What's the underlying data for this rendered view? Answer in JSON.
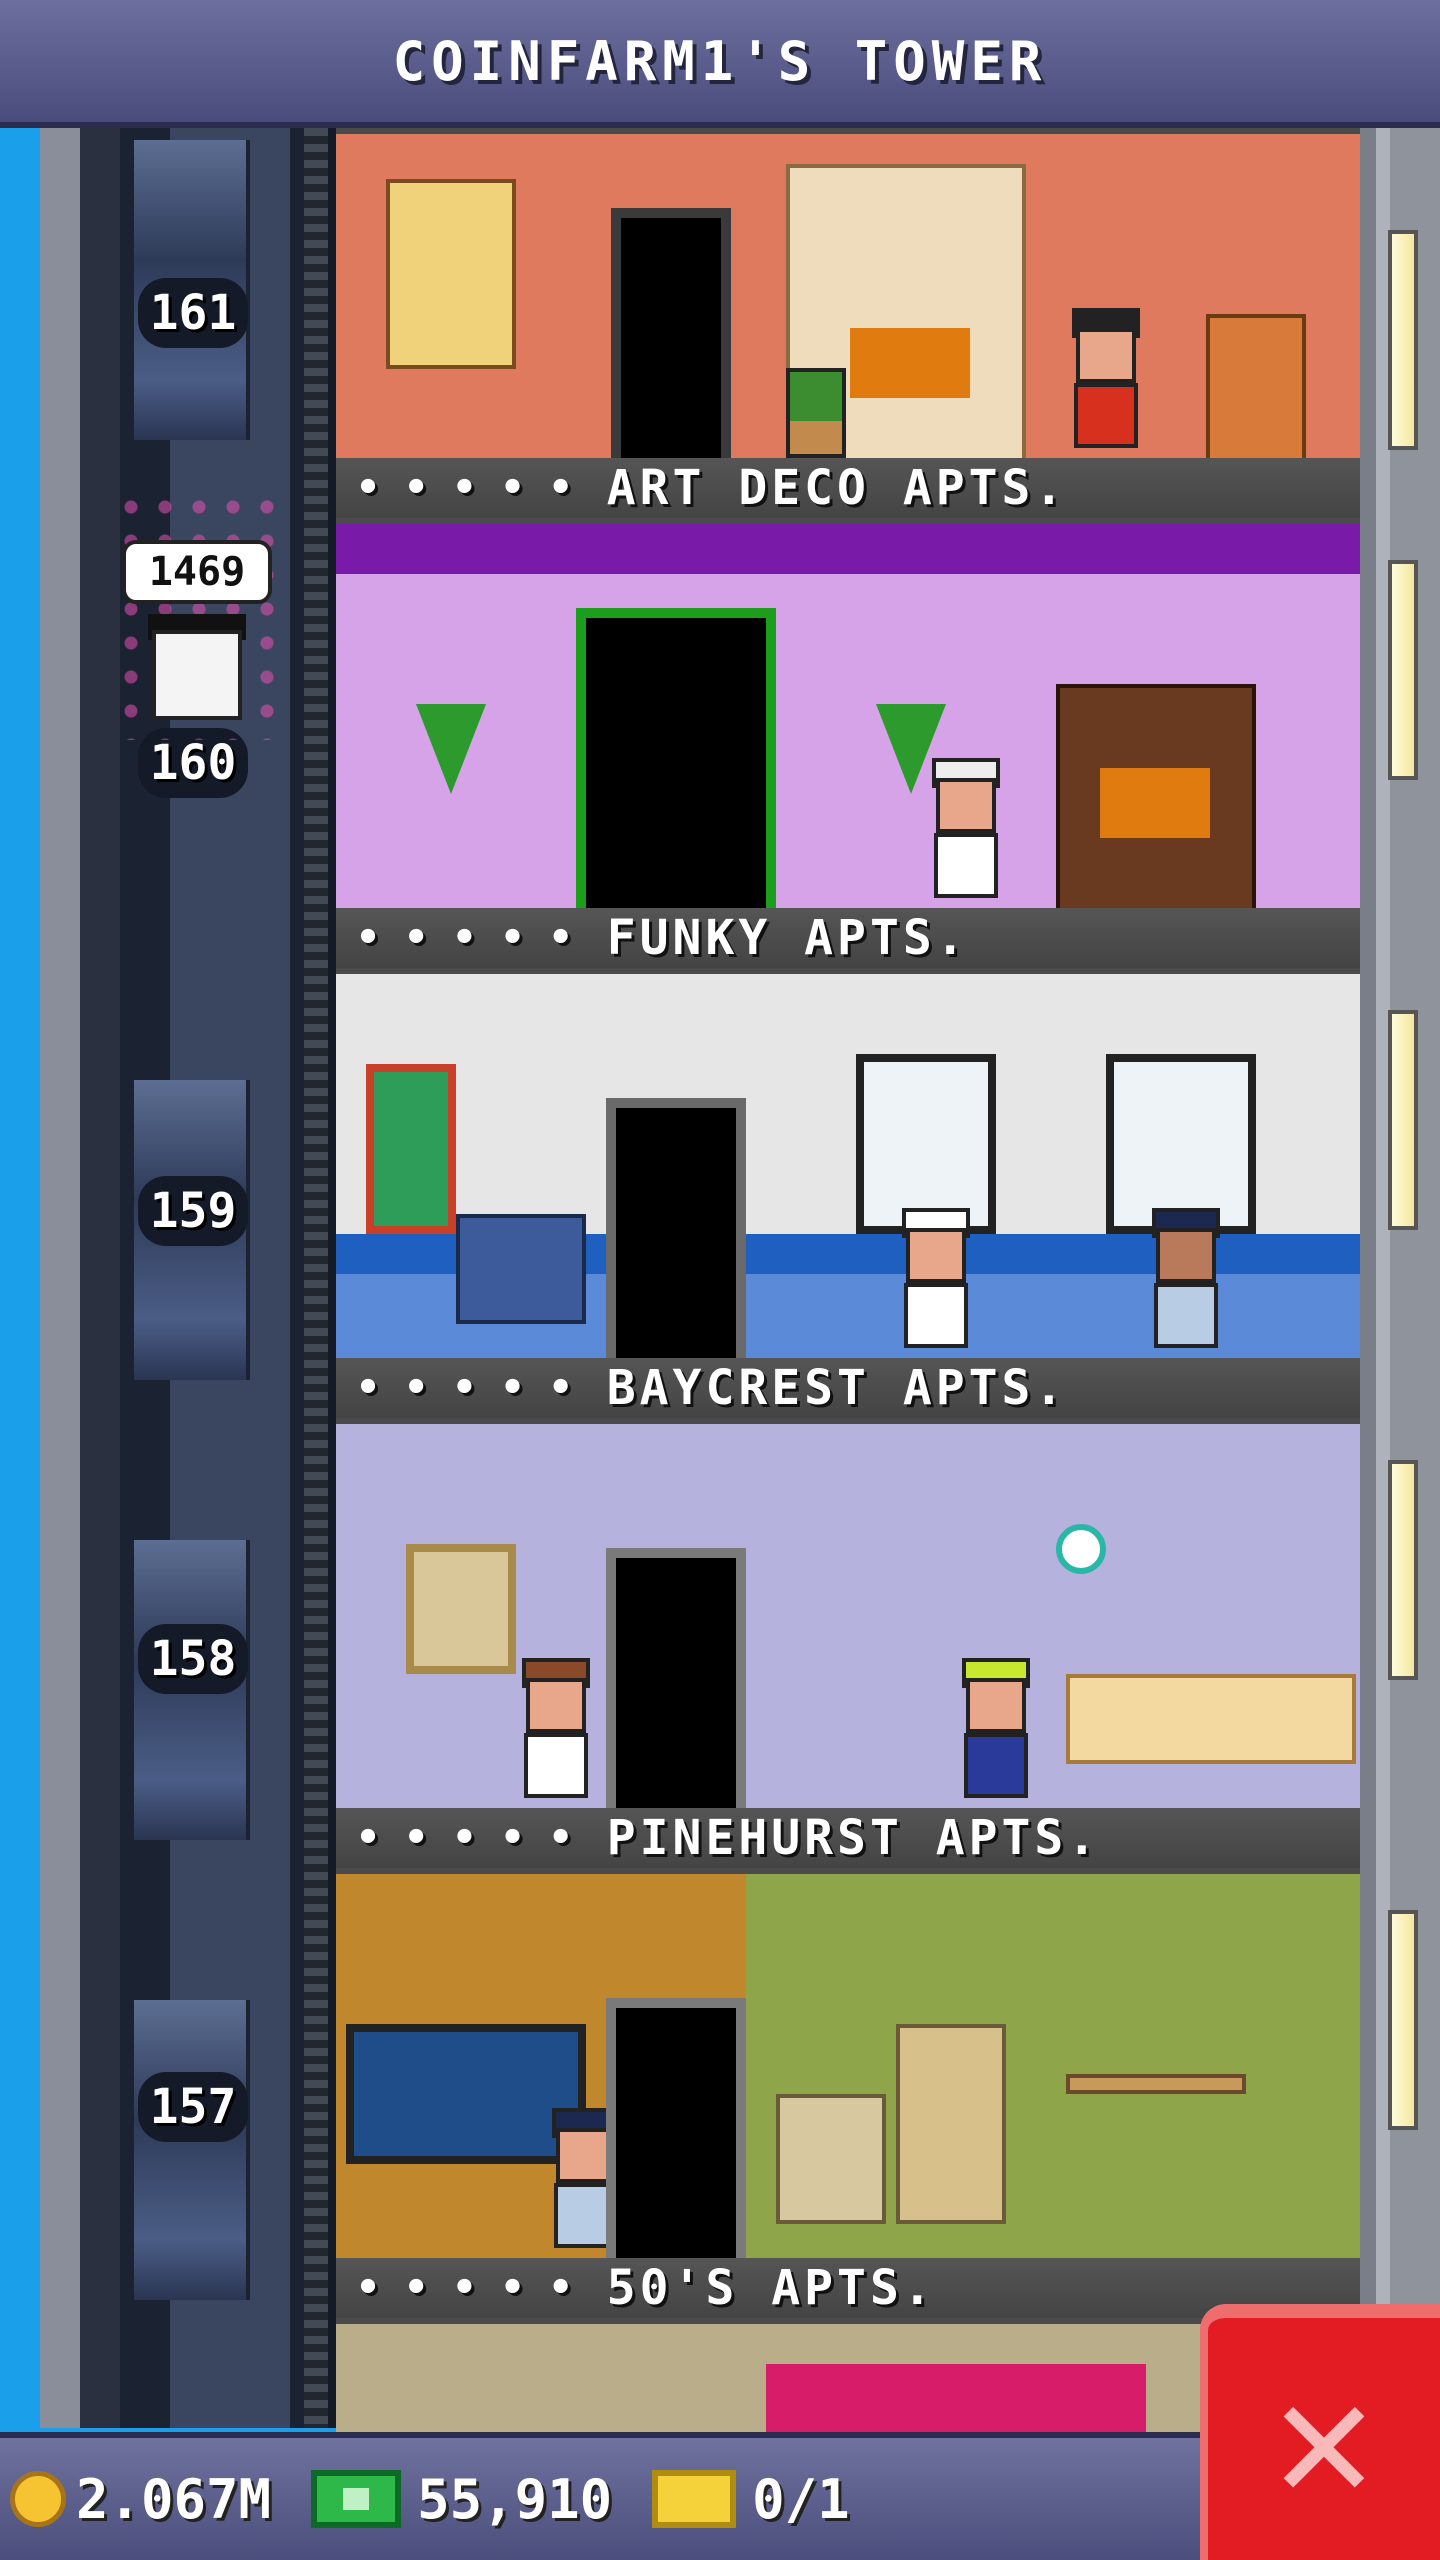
{
  "header": {
    "title": "COINFARM1'S TOWER"
  },
  "elevator": {
    "speech_value": "1469",
    "floor_badges": [
      "161",
      "160",
      "159",
      "158",
      "157"
    ]
  },
  "floors": [
    {
      "sign": "ART DECO APTS.",
      "dots": "• • • • •"
    },
    {
      "sign": "FUNKY APTS.",
      "dots": "• • • • •"
    },
    {
      "sign": "BAYCREST APTS.",
      "dots": "• • • • •"
    },
    {
      "sign": "PINEHURST APTS.",
      "dots": "• • • • •"
    },
    {
      "sign": "50'S APTS.",
      "dots": "• • • • •"
    }
  ],
  "bottom_bar": {
    "coins": "2.067M",
    "cash": "55,910",
    "golden_tickets": "0/1"
  },
  "icons": {
    "coin": "coin-icon",
    "cash": "cash-icon",
    "golden_ticket": "golden-ticket-icon",
    "close": "close-icon"
  },
  "colors": {
    "header_bg": "#4a4c7c",
    "close_red": "#e31b23",
    "sky": "#1aa0ea"
  }
}
